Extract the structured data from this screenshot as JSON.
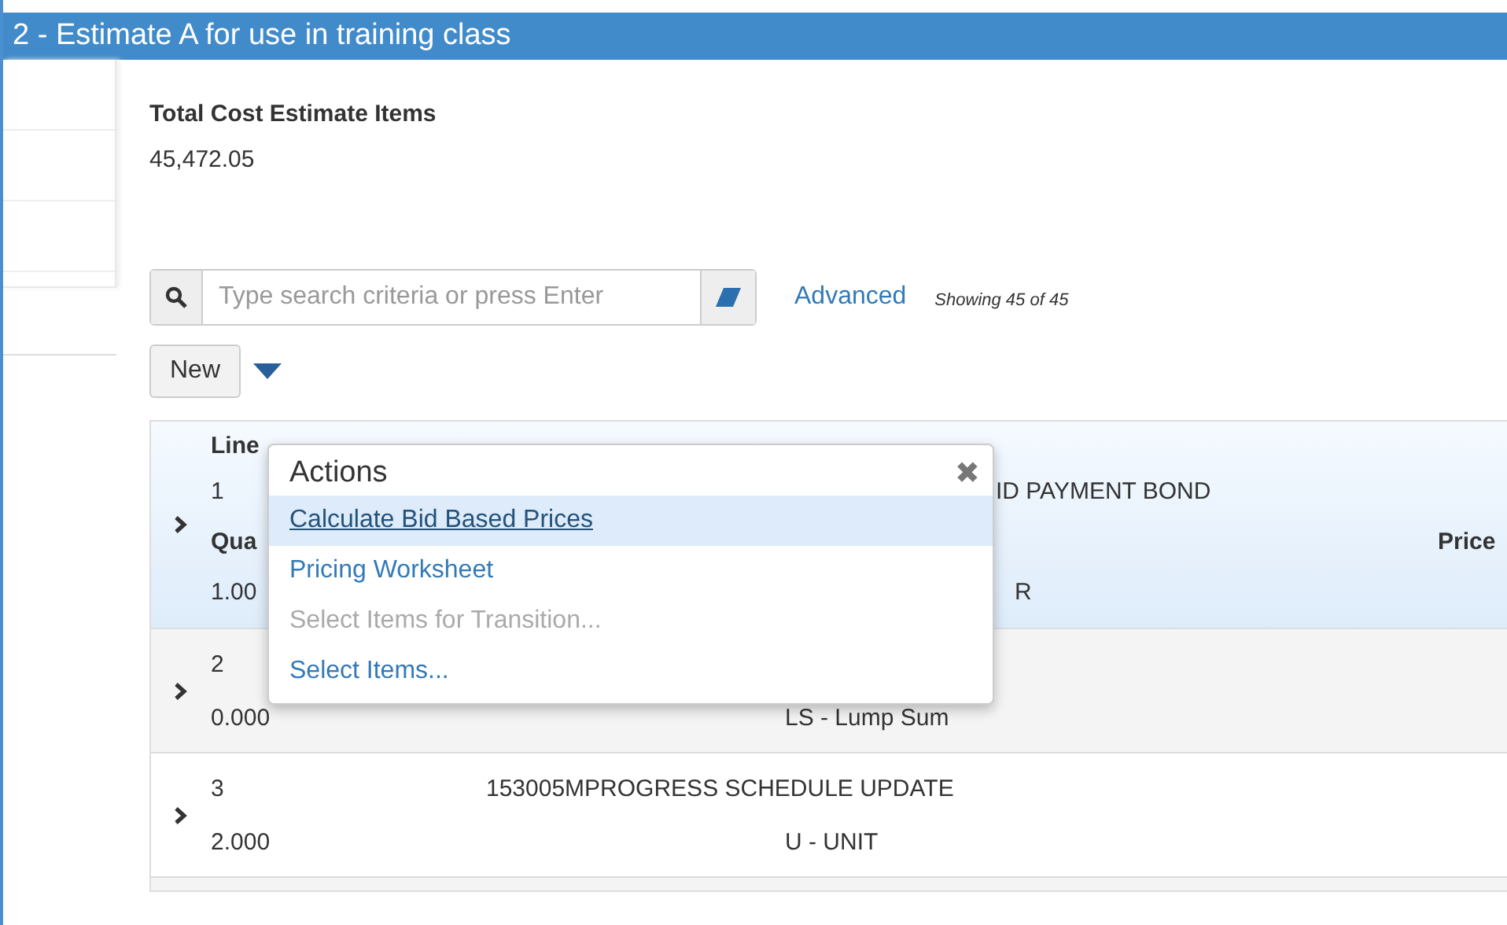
{
  "window": {
    "title": "2 - Estimate A for use in training class"
  },
  "summary": {
    "label": "Total Cost Estimate Items",
    "value": "45,472.05"
  },
  "search": {
    "placeholder": "Type search criteria or press Enter",
    "advanced": "Advanced",
    "count": "Showing 45 of 45"
  },
  "new_button": "New",
  "actions_menu": {
    "title": "Actions",
    "close": "✖",
    "items": [
      {
        "label": "Calculate Bid Based Prices",
        "selected": true,
        "disabled": false
      },
      {
        "label": "Pricing Worksheet",
        "selected": false,
        "disabled": false
      },
      {
        "label": "Select Items for Transition...",
        "selected": false,
        "disabled": true
      },
      {
        "label": "Select Items...",
        "selected": false,
        "disabled": false
      }
    ]
  },
  "table": {
    "rows": [
      {
        "selected": true,
        "line_label": "Line",
        "line": "1",
        "description": "ID PAYMENT BOND",
        "quantity_label": "Qua",
        "quantity": "1.00",
        "unit": "R",
        "price_label": "Price"
      },
      {
        "selected": false,
        "line": "2",
        "quantity": "0.000",
        "unit": "LS - Lump Sum"
      },
      {
        "selected": false,
        "line": "3",
        "description": "153005MPROGRESS SCHEDULE UPDATE",
        "quantity": "2.000",
        "unit": "U - UNIT"
      }
    ]
  }
}
